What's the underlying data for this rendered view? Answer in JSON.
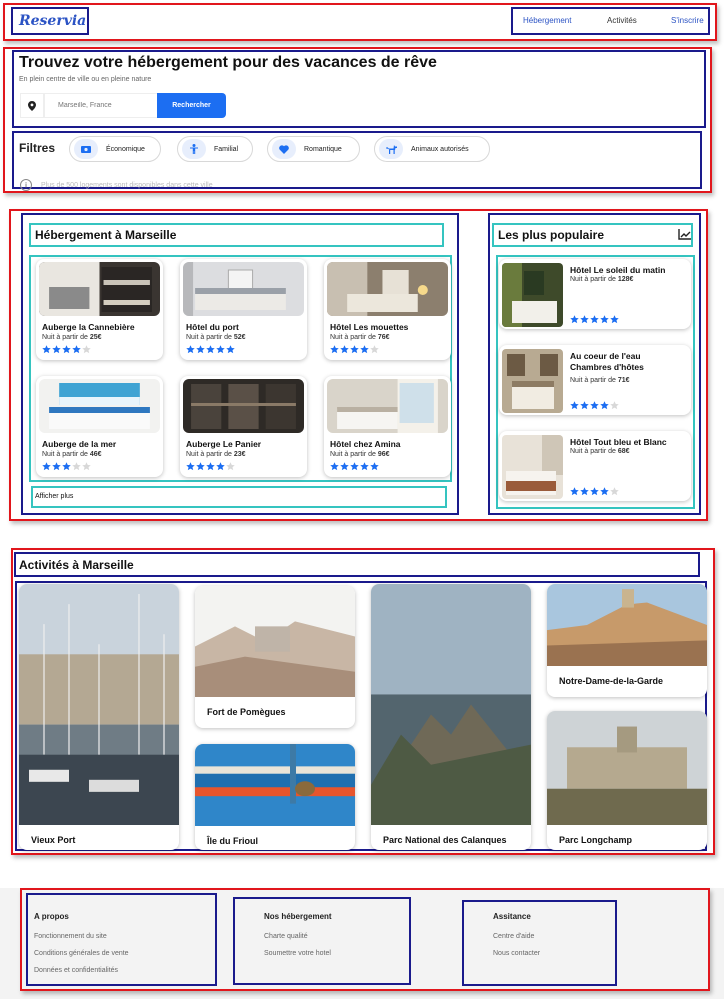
{
  "header": {
    "logo": "Reservia",
    "nav": [
      "Hébergement",
      "Activités",
      "S'inscrire"
    ]
  },
  "hero": {
    "title": "Trouvez votre hébergement pour des vacances de rêve",
    "subtitle": "En plein centre de ville ou en pleine nature",
    "search": {
      "placeholder": "Marseille, France",
      "button": "Rechercher"
    }
  },
  "filters": {
    "title": "Filtres",
    "items": [
      {
        "label": "Économique",
        "icon": "money-icon"
      },
      {
        "label": "Familial",
        "icon": "child-icon"
      },
      {
        "label": "Romantique",
        "icon": "heart-icon"
      },
      {
        "label": "Animaux autorisés",
        "icon": "dog-icon"
      }
    ],
    "info": "Plus de 500 logements sont disponibles dans cette ville"
  },
  "lodging": {
    "title": "Hébergement à Marseille",
    "price_prefix": "Nuit à partir de",
    "cards": [
      {
        "name": "Auberge la Cannebière",
        "price": "25€",
        "rating": 4
      },
      {
        "name": "Hôtel du port",
        "price": "52€",
        "rating": 5
      },
      {
        "name": "Hôtel Les mouettes",
        "price": "76€",
        "rating": 4
      },
      {
        "name": "Auberge de la mer",
        "price": "46€",
        "rating": 3
      },
      {
        "name": "Auberge Le Panier",
        "price": "23€",
        "rating": 4
      },
      {
        "name": "Hôtel chez Amina",
        "price": "96€",
        "rating": 5
      }
    ],
    "more": "Afficher plus"
  },
  "popular": {
    "title": "Les plus populaire",
    "icon": "trend-chart-icon",
    "price_prefix": "Nuit à partir de",
    "items": [
      {
        "name": "Hôtel Le soleil du matin",
        "price": "128€",
        "rating": 5
      },
      {
        "name": "Au coeur de l'eau Chambres d'hôtes",
        "price": "71€",
        "rating": 4
      },
      {
        "name": "Hôtel Tout bleu et Blanc",
        "price": "68€",
        "rating": 4
      }
    ]
  },
  "activities": {
    "title": "Activités à Marseille",
    "items": [
      "Vieux Port",
      "Fort de Pomègues",
      "Île du Frioul",
      "Parc National des Calanques",
      "Notre-Dame-de-la-Garde",
      "Parc Longchamp"
    ]
  },
  "footer": {
    "columns": [
      {
        "title": "A propos",
        "links": [
          "Fonctionnement du site",
          "Conditions générales de vente",
          "Données et confidentialités"
        ]
      },
      {
        "title": "Nos hébergement",
        "links": [
          "Charte qualité",
          "Soumettre votre hotel"
        ]
      },
      {
        "title": "Assitance",
        "links": [
          "Centre d'aide",
          "Nous contacter"
        ]
      }
    ]
  },
  "colors": {
    "accent": "#1c6ef2",
    "star_on": "#1c6ef2",
    "star_off": "#d8d8d8",
    "outline_red": "#e1161c",
    "outline_blue": "#1a1a8c",
    "outline_teal": "#35c4c0"
  }
}
